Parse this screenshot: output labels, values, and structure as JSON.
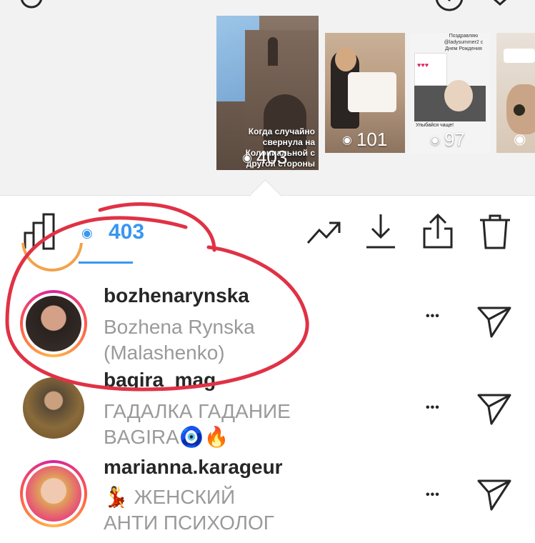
{
  "stories": {
    "first": {
      "views": "403",
      "caption": "Когда случайно свернула на Колониальной с другой стороны"
    },
    "second": {
      "views": "101"
    },
    "third": {
      "views": "97",
      "header": "Поздравляю @ladysummer2 с Днем Рождения",
      "footer": "Улыбайся чаще!"
    }
  },
  "toolbar": {
    "view_count": "403"
  },
  "viewers": [
    {
      "username": "bozhenarynska",
      "name_line1": "Bozhena Rynska",
      "name_line2": "(Malashenko)"
    },
    {
      "username": "bagira_mag",
      "name_line1": "ГАДАЛКА ГАДАНИЕ",
      "name_line2": "BAGIRA🧿🔥"
    },
    {
      "username": "marianna.karageur",
      "name_line1": "💃 ЖЕНСКИЙ",
      "name_line2": "АНТИ ПСИХОЛОГ"
    }
  ],
  "menu_dots": "•••",
  "colors": {
    "accent": "#3897f0",
    "annotation": "#e03245"
  }
}
